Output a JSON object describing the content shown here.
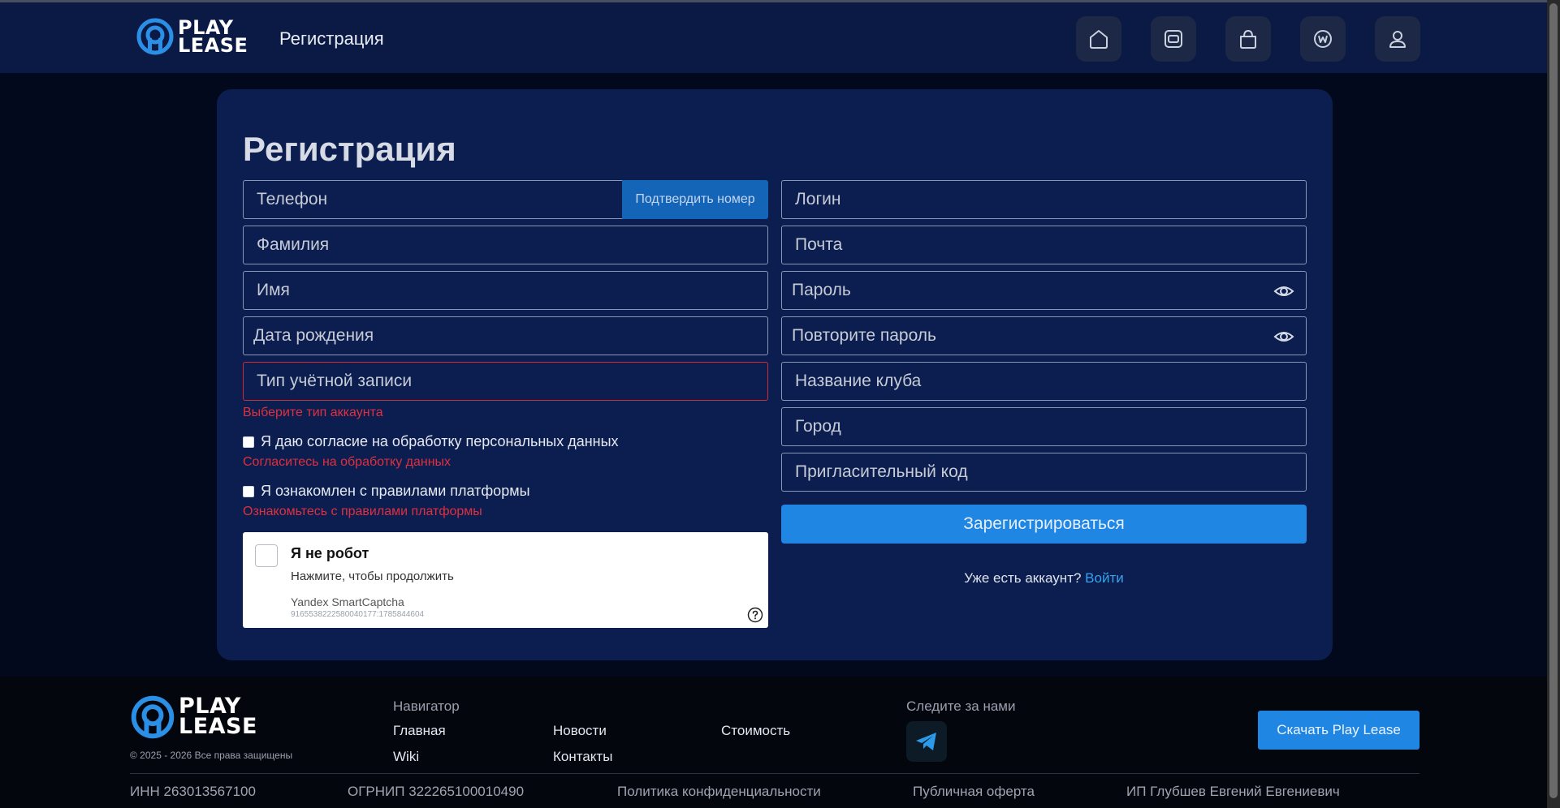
{
  "header": {
    "logo_line1": "PLAY",
    "logo_line2": "LEASE",
    "title": "Регистрация",
    "nav_icons": [
      "home-icon",
      "wallet-icon",
      "bag-icon",
      "wiki-icon",
      "user-icon"
    ]
  },
  "form": {
    "heading": "Регистрация",
    "phone_placeholder": "Телефон",
    "confirm_label": "Подтвердить номер",
    "lastname_placeholder": "Фамилия",
    "firstname_placeholder": "Имя",
    "birthdate_placeholder": "Дата рождения",
    "account_type_placeholder": "Тип учётной записи",
    "account_type_error": "Выберите тип аккаунта",
    "consent_label": "Я даю согласие на обработку персональных данных",
    "consent_error": "Согласитесь на обработку данных",
    "rules_label": "Я ознакомлен с правилами платформы",
    "rules_error": "Ознакомьтесь с правилами платформы",
    "login_placeholder": "Логин",
    "email_placeholder": "Почта",
    "password_placeholder": "Пароль",
    "password_repeat_placeholder": "Повторите пароль",
    "club_placeholder": "Название клуба",
    "city_placeholder": "Город",
    "invite_placeholder": "Пригласительный код",
    "submit_label": "Зарегистрироваться",
    "have_account": "Уже есть аккаунт?",
    "login_link": "Войти"
  },
  "captcha": {
    "title": "Я не робот",
    "subtitle": "Нажмите, чтобы продолжить",
    "brand": "Yandex SmartCaptcha",
    "id": "9165538222580040177:1785844604"
  },
  "footer": {
    "logo_line1": "PLAY",
    "logo_line2": "LEASE",
    "copyright": "© 2025 - 2026 Все права защищены",
    "nav_heading": "Навигатор",
    "nav_links": [
      "Главная",
      "Новости",
      "Стоимость",
      "Wiki",
      "Контакты"
    ],
    "follow_heading": "Следите за нами",
    "download_label": "Скачать Play Lease",
    "legal": [
      "ИНН 263013567100",
      "ОГРНИП 322265100010490",
      "Политика конфиденциальности",
      "Публичная оферта",
      "ИП Глубшев Евгений Евгениевич"
    ]
  },
  "colors": {
    "accent": "#1f86e4",
    "error": "#e0303f",
    "header_bg": "#0b1a45",
    "card_bg": "#0b1e4f"
  }
}
